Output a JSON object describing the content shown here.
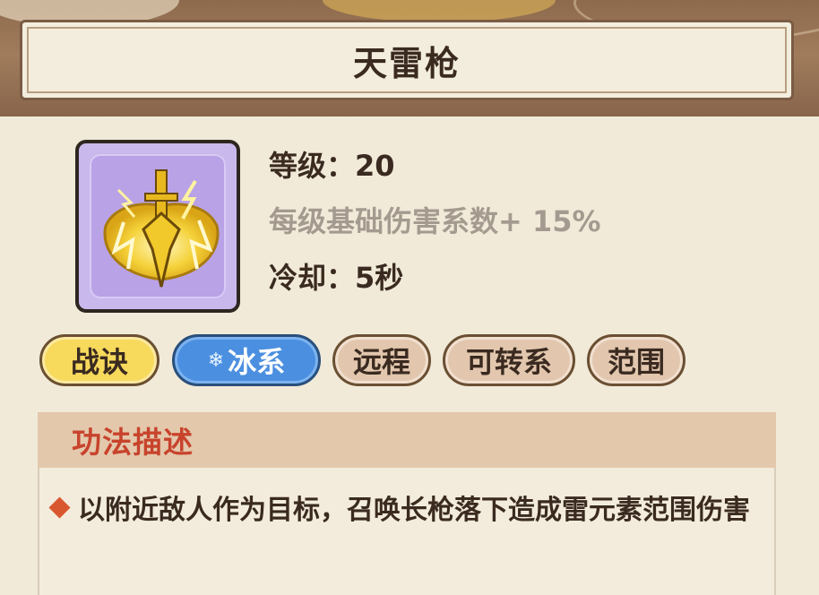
{
  "skill": {
    "name": "天雷枪",
    "level_label": "等级：",
    "level_value": "20",
    "bonus_text": "每级基础伤害系数+ 15%",
    "cooldown_label": "冷却：",
    "cooldown_value": "5秒",
    "icon": "thunder-spear-icon"
  },
  "tags": [
    {
      "label": "战诀",
      "style": "gold"
    },
    {
      "label": "冰系",
      "style": "blue",
      "icon": "snowflake-icon"
    },
    {
      "label": "远程",
      "style": "brown"
    },
    {
      "label": "可转系",
      "style": "brown"
    },
    {
      "label": "范围",
      "style": "brown"
    }
  ],
  "description": {
    "title": "功法描述",
    "text": "以附近敌人作为目标，召唤长枪落下造成雷元素范围伤害"
  },
  "colors": {
    "title_bar_border": "#7b5c44",
    "gold_tag": "#f7d95c",
    "blue_tag": "#4b8fe0",
    "brown_tag": "#e2c7ae",
    "desc_title": "#c8432c",
    "icon_bg": "#b9a2e6"
  }
}
